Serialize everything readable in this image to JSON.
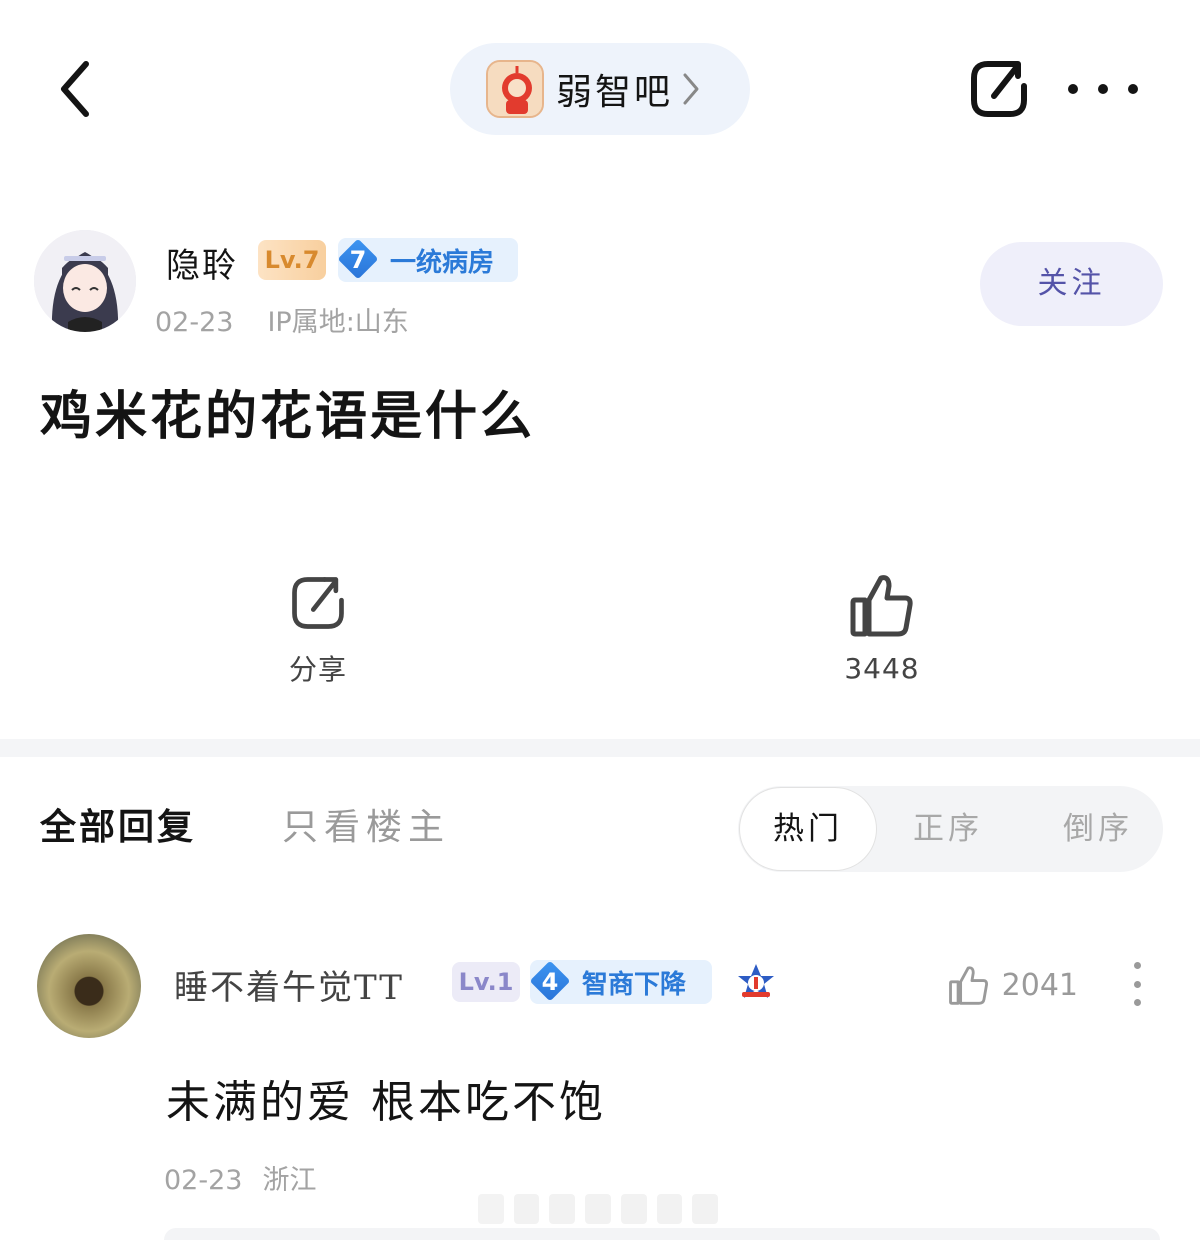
{
  "topbar": {
    "back_icon": "chevron-left-icon",
    "forum_name": "弱智吧",
    "share_icon": "share-icon",
    "more_icon": "more-horizontal-icon"
  },
  "author": {
    "name": "隐聆",
    "level": "Lv.7",
    "title_level": "7",
    "title_text": "一统病房",
    "date": "02-23",
    "ip": "IP属地:山东",
    "follow_label": "关注"
  },
  "post": {
    "title": "鸡米花的花语是什么",
    "share_label": "分享",
    "like_count": "3448"
  },
  "replies": {
    "tab_all": "全部回复",
    "tab_lz": "只看楼主",
    "sort_options": [
      "热门",
      "正序",
      "倒序"
    ],
    "active_sort": "热门"
  },
  "comment": {
    "name": "睡不着午觉TT",
    "level": "Lv.1",
    "title_level": "4",
    "title_text": "智商下降",
    "like_count": "2041",
    "text": "未满的爱 根本吃不饱",
    "date": "02-23",
    "location": "浙江"
  },
  "colors": {
    "accent_blue": "#2b7ad8",
    "follow_text": "#5453a8",
    "meta_gray": "#a3a3a3"
  }
}
